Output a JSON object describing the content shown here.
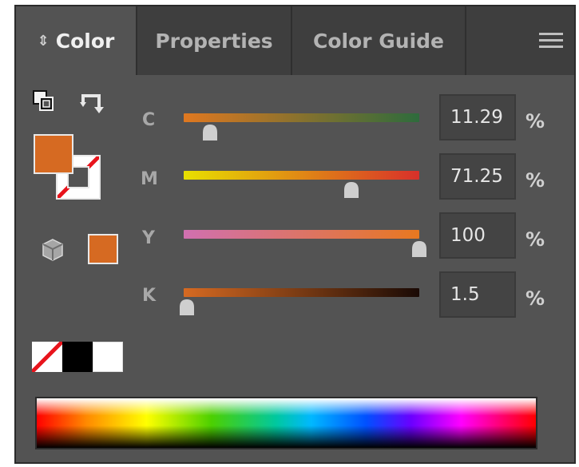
{
  "tabs": [
    {
      "label": "Color",
      "active": true
    },
    {
      "label": "Properties",
      "active": false
    },
    {
      "label": "Color Guide",
      "active": false
    }
  ],
  "colors": {
    "fill": "#d66a22",
    "oog_swatch": "#d66a22",
    "panel_bg": "#535353"
  },
  "icons": [
    "default-fill-stroke-icon",
    "swap-fill-stroke-icon",
    "out-of-gamut-cube-icon",
    "panel-menu-icon",
    "tab-updown-icon"
  ],
  "channels": [
    {
      "label": "C",
      "value": "11.29",
      "unit": "%",
      "level": 11.29,
      "gradient": [
        "#e07820",
        "#2e6b3c"
      ]
    },
    {
      "label": "M",
      "value": "71.25",
      "unit": "%",
      "level": 71.25,
      "gradient": [
        "#e8e000",
        "#d8302a"
      ]
    },
    {
      "label": "Y",
      "value": "100",
      "unit": "%",
      "level": 100,
      "gradient": [
        "#d070b0",
        "#e87820"
      ]
    },
    {
      "label": "K",
      "value": "1.5",
      "unit": "%",
      "level": 1.5,
      "gradient": [
        "#d66a22",
        "#1a0a05"
      ]
    }
  ],
  "quick_swatches": [
    "none",
    "black",
    "white"
  ]
}
